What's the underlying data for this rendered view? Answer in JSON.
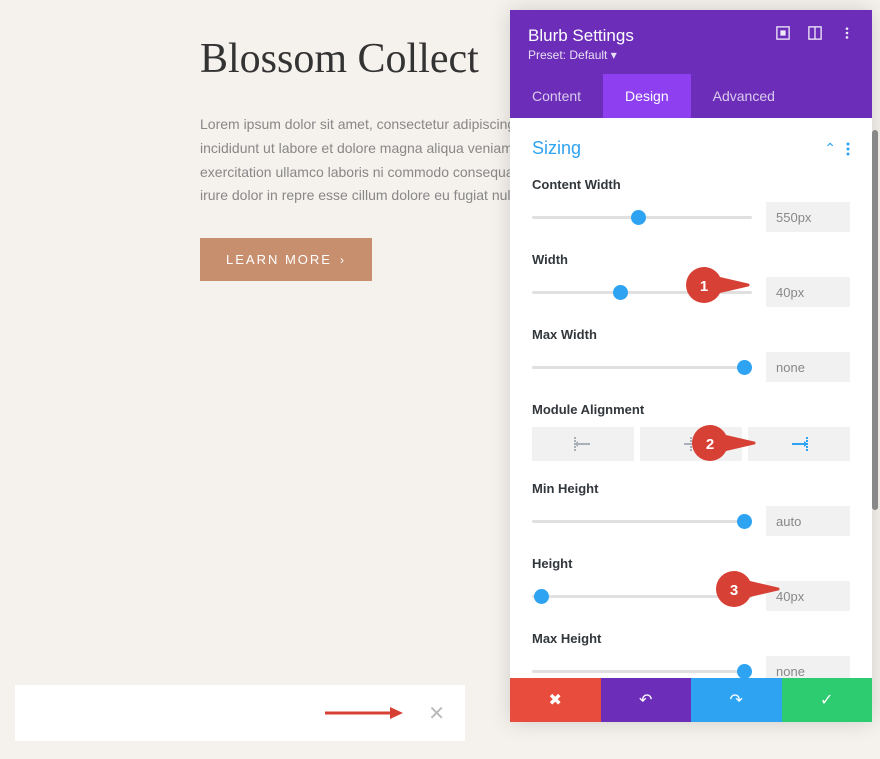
{
  "page": {
    "title": "Blossom Collect",
    "body": "Lorem ipsum dolor sit amet, consectetur adipiscing tempor incididunt ut labore et dolore magna aliqua veniam, quis nostrud exercitation ullamco laboris ni commodo consequat. Duis aute irure dolor in repre esse cillum dolore eu fugiat nulla pariatur",
    "learn_more": "LEARN MORE"
  },
  "panel": {
    "title": "Blurb Settings",
    "preset_label": "Preset: Default",
    "tabs": {
      "content": "Content",
      "design": "Design",
      "advanced": "Advanced"
    }
  },
  "section": {
    "title": "Sizing"
  },
  "fields": {
    "content_width": {
      "label": "Content Width",
      "value": "550px",
      "pos": 45
    },
    "width": {
      "label": "Width",
      "value": "40px",
      "pos": 37
    },
    "max_width": {
      "label": "Max Width",
      "value": "none",
      "pos": 93
    },
    "module_alignment": {
      "label": "Module Alignment"
    },
    "min_height": {
      "label": "Min Height",
      "value": "auto",
      "pos": 93
    },
    "height": {
      "label": "Height",
      "value": "40px",
      "pos": 1
    },
    "max_height": {
      "label": "Max Height",
      "value": "none",
      "pos": 93
    }
  },
  "callouts": {
    "c1": "1",
    "c2": "2",
    "c3": "3"
  }
}
